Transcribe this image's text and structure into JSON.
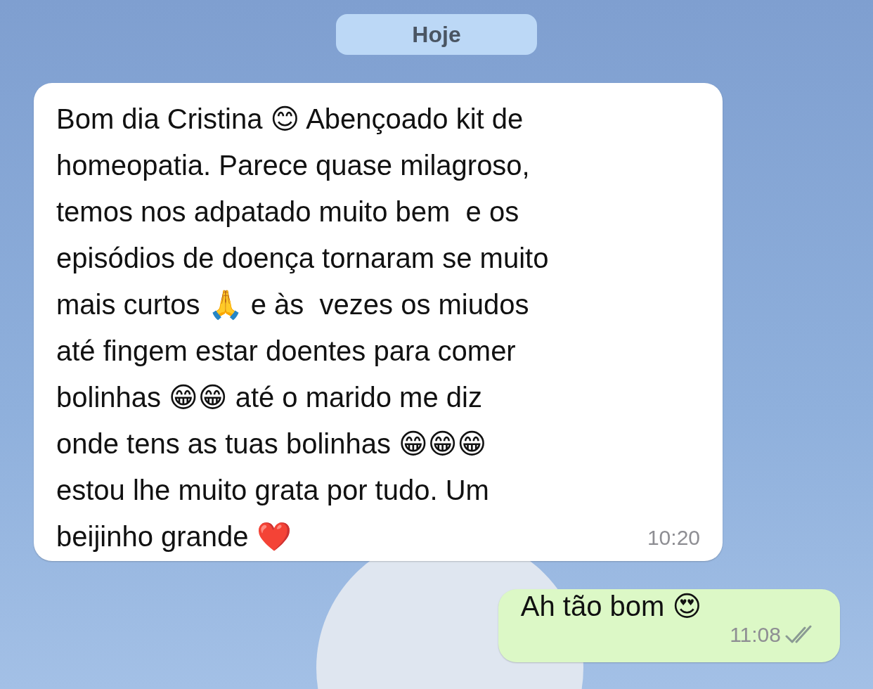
{
  "date_chip": "Hoje",
  "messages": [
    {
      "kind": "incoming",
      "text": "Bom dia Cristina 😊 Abençoado kit de\nhomeopatia. Parece quase milagroso,\ntemos nos adpatado muito bem  e os\nepisódios de doença tornaram se muito\nmais curtos 🙏 e às  vezes os miudos\naté fingem estar doentes para comer\nbolinhas 😁😁 até o marido me diz\nonde tens as tuas bolinhas 😁😁😁\nestou lhe muito grata por tudo. Um\nbeijinho grande ❤️",
      "time": "10:20"
    },
    {
      "kind": "outgoing",
      "text": "Ah tão bom 😍",
      "time": "11:08"
    }
  ]
}
